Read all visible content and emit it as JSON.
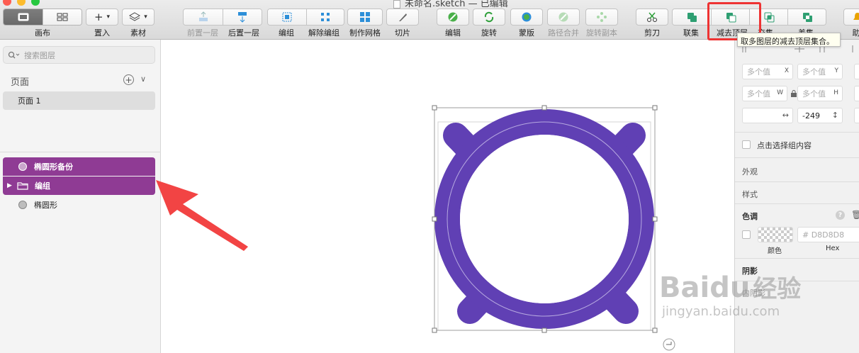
{
  "window": {
    "title": "未命名.sketch — 已编辑"
  },
  "toolbar": {
    "canvas_label": "画布",
    "insert_label": "置入",
    "symbols_label": "素材",
    "forward_label": "前置一层",
    "backward_label": "后置一层",
    "group_label": "编组",
    "ungroup_label": "解除编组",
    "grid_label": "制作网格",
    "slice_label": "切片",
    "edit_label": "编辑",
    "rotate_label": "旋转",
    "mask_label": "蒙版",
    "path_merge_label": "路径合并",
    "rotate_copies_label": "旋转副本",
    "scissors_label": "剪刀",
    "union_label": "联集",
    "subtract_label": "减去顶层",
    "intersect_label": "交集",
    "difference_label": "差集",
    "assist_label": "助",
    "tooltip": "取多图层的减去顶层集合。"
  },
  "sidebar": {
    "search_placeholder": "搜索图层",
    "pages_title": "页面",
    "pages": [
      "页面 1"
    ],
    "layers": [
      {
        "name": "椭圆形备份",
        "kind": "oval",
        "selected": true
      },
      {
        "name": "编组",
        "kind": "group",
        "selected": true
      },
      {
        "name": "椭圆形",
        "kind": "oval",
        "selected": false
      }
    ]
  },
  "inspector": {
    "x_placeholder": "多个值",
    "x_unit": "X",
    "y_placeholder": "多个值",
    "y_unit": "Y",
    "w_placeholder": "多个值",
    "w_unit": "W",
    "h_placeholder": "多个值",
    "h_unit": "H",
    "rotation_value": "-249",
    "click_select_label": "点击选择组内容",
    "appearance_label": "外观",
    "style_label": "样式",
    "tint_label": "色调",
    "hex_placeholder": "# D8D8D8",
    "color_caption": "颜色",
    "hex_caption": "Hex",
    "shadow_label": "阴影",
    "partial_label": "内阴影"
  },
  "watermark": {
    "brand": "Baidu",
    "cn": "经验",
    "url": "jingyan.baidu.com"
  },
  "colors": {
    "accent_purple": "#6040b4",
    "layer_selected": "#8f3b94",
    "highlight_red": "#ee3333"
  }
}
